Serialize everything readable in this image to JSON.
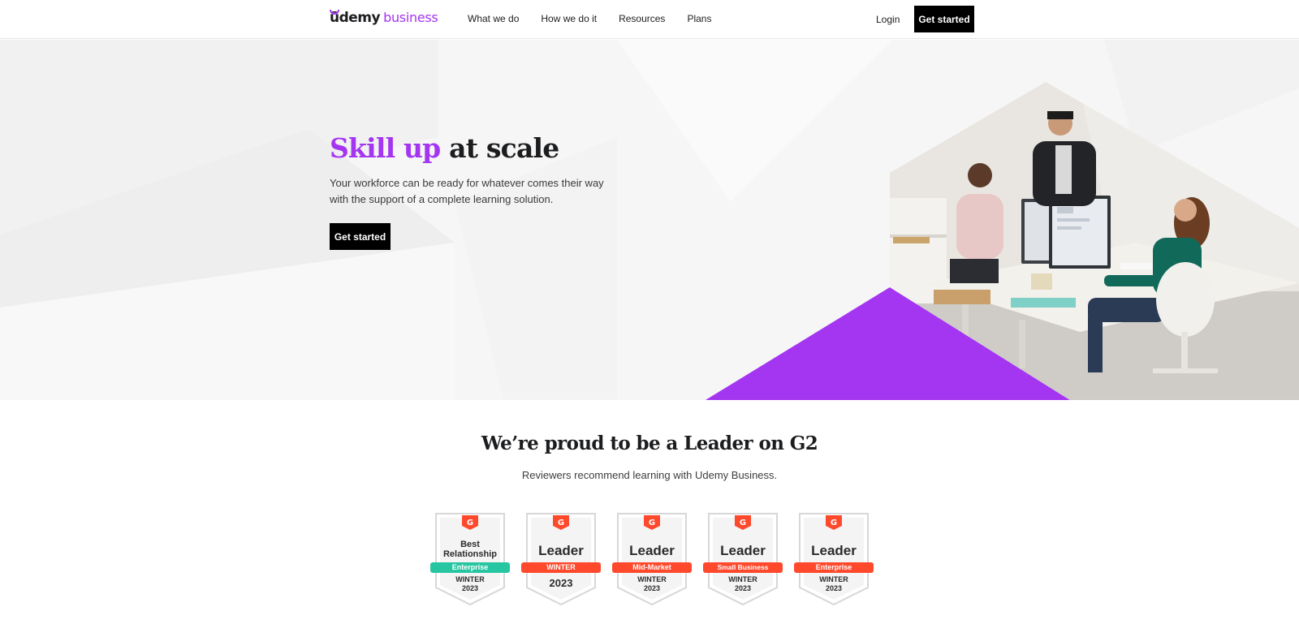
{
  "header": {
    "logo": {
      "mark": "ūdemy",
      "word": "business"
    },
    "nav": [
      {
        "label": "What we do"
      },
      {
        "label": "How we do it"
      },
      {
        "label": "Resources"
      },
      {
        "label": "Plans"
      }
    ],
    "login_label": "Login",
    "cta_label": "Get started"
  },
  "hero": {
    "title_accent": "Skill up",
    "title_rest": "at scale",
    "subtitle": "Your workforce can be ready for whatever comes their way with the support of a complete learning solution.",
    "cta_label": "Get started",
    "accent_color": "#a435f0"
  },
  "g2": {
    "title": "We’re proud to be a Leader on G2",
    "subtitle": "Reviewers recommend learning with Udemy Business.",
    "badges": [
      {
        "title_line1": "Best",
        "title_line2": "Relationship",
        "ribbon": "Enterprise",
        "season_line1": "WINTER",
        "season_line2": "2023",
        "ribbon_color": "#26c6a2"
      },
      {
        "title_line1": "Leader",
        "title_line2": "",
        "ribbon": "WINTER",
        "season_line1": "2023",
        "season_line2": "",
        "ribbon_color": "#ff492c"
      },
      {
        "title_line1": "Leader",
        "title_line2": "",
        "ribbon": "Mid-Market",
        "season_line1": "WINTER",
        "season_line2": "2023",
        "ribbon_color": "#ff492c"
      },
      {
        "title_line1": "Leader",
        "title_line2": "",
        "ribbon": "Small Business",
        "season_line1": "WINTER",
        "season_line2": "2023",
        "ribbon_color": "#ff492c"
      },
      {
        "title_line1": "Leader",
        "title_line2": "",
        "ribbon": "Enterprise",
        "season_line1": "WINTER",
        "season_line2": "2023",
        "ribbon_color": "#ff492c"
      }
    ]
  }
}
